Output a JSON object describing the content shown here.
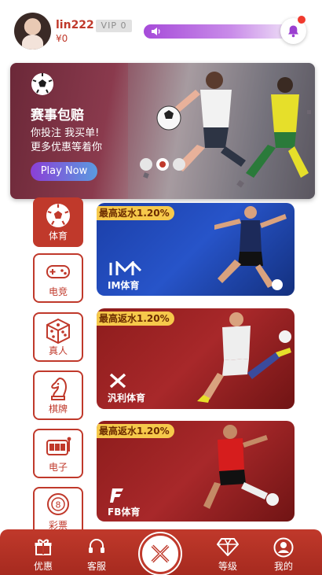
{
  "header": {
    "username": "lin222",
    "vip": "VIP 0",
    "balance": "¥0"
  },
  "hero": {
    "title": "赛事包赔",
    "line1": "你投注 我买单!",
    "line2": "更多优惠等着你",
    "button": "Play Now",
    "slides": 3,
    "active_slide": 2
  },
  "categories": [
    {
      "label": "体育",
      "icon": "soccer-ball-icon",
      "active": true
    },
    {
      "label": "电竞",
      "icon": "gamepad-icon",
      "active": false
    },
    {
      "label": "真人",
      "icon": "dice-icon",
      "active": false
    },
    {
      "label": "棋牌",
      "icon": "chess-knight-icon",
      "active": false
    },
    {
      "label": "电子",
      "icon": "slot-machine-icon",
      "active": false
    },
    {
      "label": "彩票",
      "icon": "lottery-ball-icon",
      "active": false
    }
  ],
  "games": [
    {
      "rebate": "最高返水1.20%",
      "name": "IM体育",
      "logo": "im-logo"
    },
    {
      "rebate": "最高返水1.20%",
      "name": "汎利体育",
      "logo": "x-logo"
    },
    {
      "rebate": "最高返水1.20%",
      "name": "FB体育",
      "logo": "fb-logo"
    }
  ],
  "nav": {
    "promo": "优惠",
    "service": "客服",
    "level": "等级",
    "mine": "我的"
  },
  "colors": {
    "brand_red": "#c0392b",
    "marquee_purple": "#a64bd9",
    "rebate_yellow": "#f6c94b"
  }
}
